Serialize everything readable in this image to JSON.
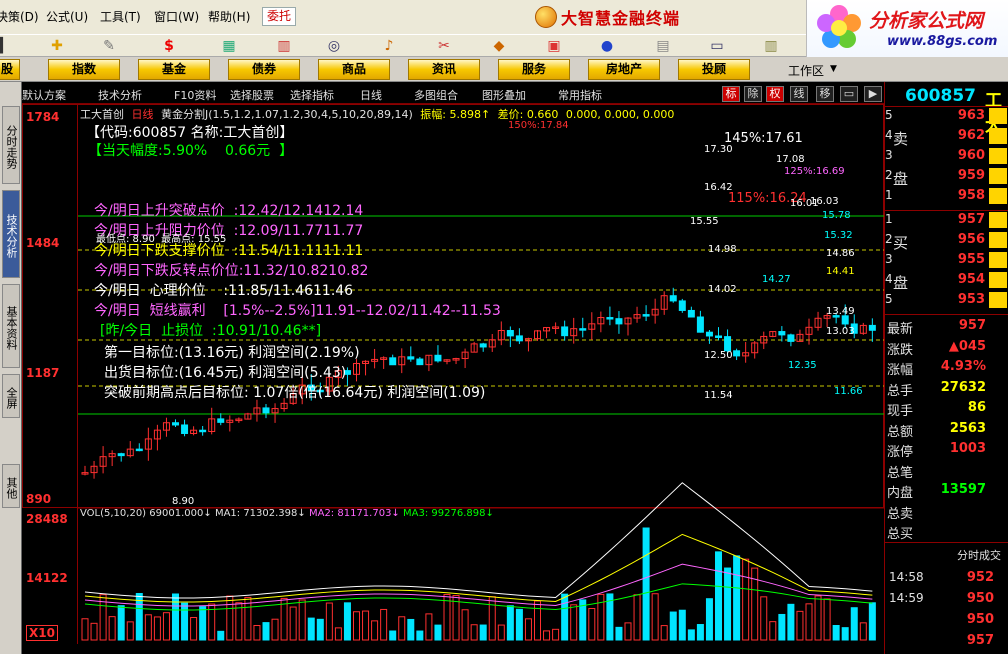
{
  "menu": {
    "items": [
      "决策(D)",
      "公式(U)",
      "工具(T)",
      "窗口(W)",
      "帮助(H)"
    ],
    "alert_tab": "委托"
  },
  "brand": {
    "title": "大智慧金融终端"
  },
  "logo": {
    "main": "分析家公式网",
    "sub": "www.88gs.com"
  },
  "categories": [
    "股",
    "指数",
    "基金",
    "债券",
    "商品",
    "资讯",
    "服务",
    "房地产",
    "投顾"
  ],
  "workspace": "工作区",
  "left_tabs": [
    "分时走势",
    "技术分析",
    "基本资料",
    "全屏",
    "其他"
  ],
  "chart_toolbar": {
    "items": [
      "默认方案",
      "技术分析",
      "F10资料",
      "选择股票",
      "选择指标",
      "日线",
      "多图组合",
      "图形叠加",
      "常用指标"
    ],
    "buttons": [
      "标",
      "除",
      "权",
      "线",
      "移"
    ]
  },
  "chart_legend": {
    "name": "工大首创",
    "period": "日线",
    "indicator": "黄金分割J(1.5,1.2,1.07,1.2,30,4,5,10,20,89,14)",
    "amplitude": "振幅: 5.898↑",
    "diff": "差价: 0.660",
    "values": "0.000, 0.000, 0.000"
  },
  "price_axis": [
    "1784",
    "1484",
    "1187",
    "890"
  ],
  "volume_axis": [
    "28488",
    "14122",
    "X10"
  ],
  "chart_annotations": [
    "145%:17.61",
    "17.30",
    "17.08",
    "125%:16.69",
    "16.42",
    "115%:16.24",
    "16.03",
    "16.01",
    "15.78",
    "15.55",
    "15.32",
    "14.98",
    "14.86",
    "14.41",
    "14.27",
    "14.02",
    "13.49",
    "13.03",
    "12.50",
    "12.35",
    "11.66",
    "11.54",
    "8.90",
    "150%:17.84"
  ],
  "overlay_text": [
    "【代码:600857 名称:工大首创】",
    "【当天幅度:5.90%    0.66元  】",
    "今/明日上升突破点价  :12.42/12.1412.14",
    "今/明日上升阻力价位  :12.09/11.7711.77",
    "今/明日下跌支撑价位  :11.54/11.1111.11",
    "今/明日下跌反转点价位:11.32/10.8210.82",
    "今/明日  心理价位    :11.85/11.4611.46",
    "今/明日  短线赢利    [1.5%--2.5%]11.91--12.02/11.42--11.53",
    "[昨/今日  止损位  :10.91/10.46**]",
    "第一目标位:(13.16元) 利润空间(2.19%)",
    "出货目标位:(16.45元) 利润空间(5.43)",
    "突破前期高点后目标位: 1.07倍(倍(16.64元) 利润空间(1.09)",
    "最低点: 8.90  最高点: 15.55"
  ],
  "volume_legend": {
    "vol": "VOL(5,10,20)",
    "v1": "69001.000↓",
    "ma1": "MA1: 71302.398↓",
    "ma2": "MA2: 81171.703↓",
    "ma3": "MA3: 99276.898↓"
  },
  "quote": {
    "code": "600857",
    "name": "工大",
    "sell_label": [
      "卖",
      "盘"
    ],
    "buy_label": [
      "买",
      "盘"
    ],
    "sell": [
      {
        "level": "5",
        "price": "963"
      },
      {
        "level": "4",
        "price": "962"
      },
      {
        "level": "3",
        "price": "960"
      },
      {
        "level": "2",
        "price": "959"
      },
      {
        "level": "1",
        "price": "958"
      }
    ],
    "buy": [
      {
        "level": "1",
        "price": "957"
      },
      {
        "level": "2",
        "price": "956"
      },
      {
        "level": "3",
        "price": "955"
      },
      {
        "level": "4",
        "price": "954"
      },
      {
        "level": "5",
        "price": "953"
      }
    ],
    "stats": [
      {
        "label": "最新",
        "value": "957",
        "color": "#ff3030"
      },
      {
        "label": "涨跌",
        "value": "▲045",
        "color": "#ff3030"
      },
      {
        "label": "涨幅",
        "value": "4.93%",
        "color": "#ff3030"
      },
      {
        "label": "总手",
        "value": "27632",
        "color": "#ffff00"
      },
      {
        "label": "现手",
        "value": "86",
        "color": "#ffff00"
      },
      {
        "label": "总额",
        "value": "2563",
        "color": "#ffff00"
      },
      {
        "label": "涨停",
        "value": "1003",
        "color": "#ff3030"
      },
      {
        "label": "总笔",
        "value": "",
        "color": "#ffff00"
      },
      {
        "label": "内盘",
        "value": "13597",
        "color": "#00ff00"
      },
      {
        "label": "总卖",
        "value": "",
        "color": "#ffff00"
      },
      {
        "label": "总买",
        "value": "",
        "color": "#ffff00"
      }
    ],
    "ticks_title": "分时成交",
    "ticks": [
      {
        "time": "14:58",
        "price": "952"
      },
      {
        "time": "14:59",
        "price": "950"
      },
      {
        "time": "",
        "price": "950"
      },
      {
        "time": "",
        "price": "957"
      }
    ]
  },
  "colors": {
    "up": "#ff3030",
    "down": "#00e5ff",
    "text": "#ffff00",
    "panel": "#ece9d8"
  }
}
